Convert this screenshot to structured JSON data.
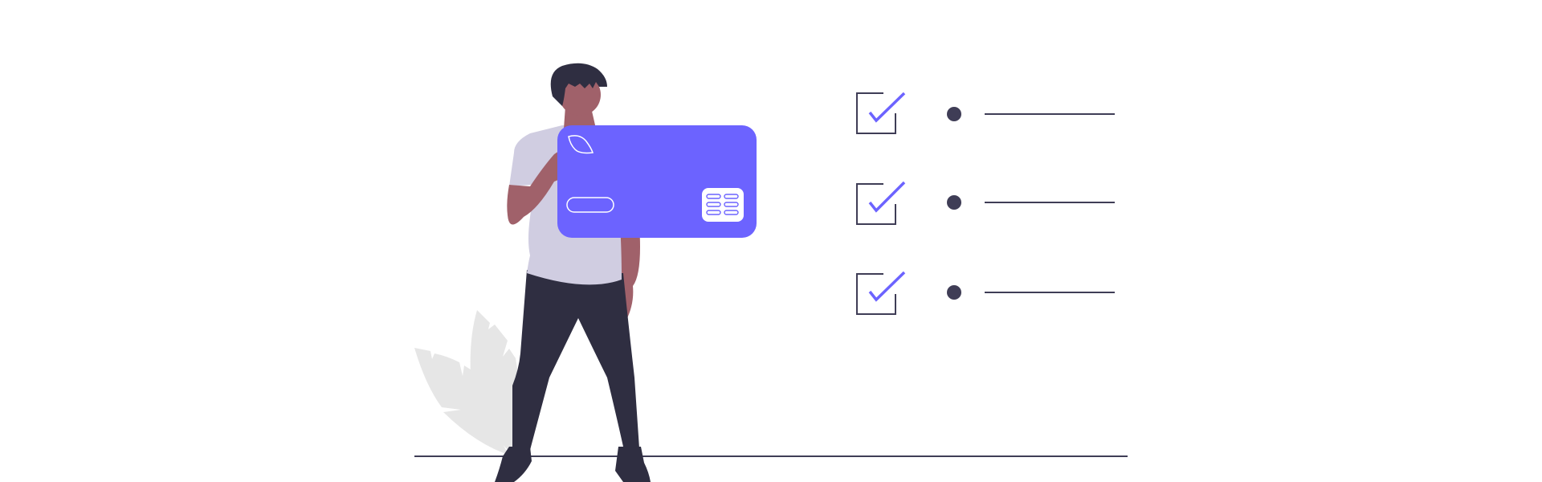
{
  "illustration": {
    "subject": "person-holding-credit-card",
    "colors": {
      "accent": "#6c63ff",
      "dark": "#2f2e41",
      "skin": "#a0616a",
      "shirt": "#d0cde1",
      "plant": "#e6e6e6",
      "background": "#ffffff",
      "card_detail": "#ffffff"
    },
    "icons": [
      "credit-card-icon",
      "checkbox-checked-icon",
      "bullet-dot-icon",
      "plant-icon"
    ],
    "checklist": {
      "items": [
        {
          "checked": true
        },
        {
          "checked": true
        },
        {
          "checked": true
        }
      ]
    }
  }
}
